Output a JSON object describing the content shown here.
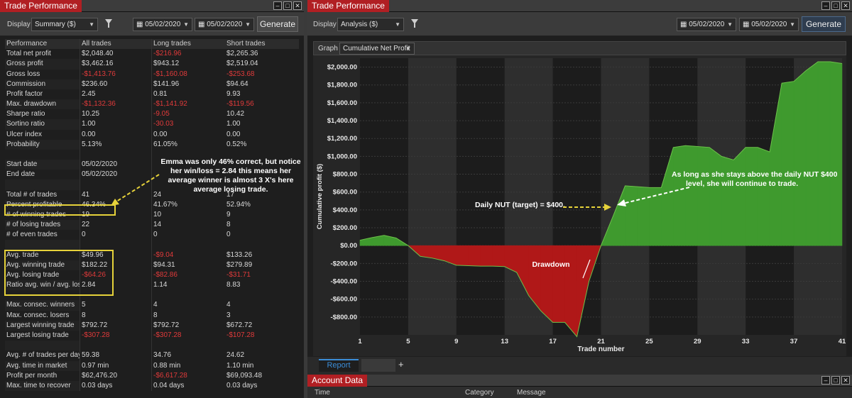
{
  "left_panel": {
    "title": "Trade Performance",
    "display_label": "Display",
    "display_value": "Summary ($)",
    "date_from": "05/02/2020",
    "date_to": "05/02/2020",
    "generate_label": "Generate"
  },
  "table": {
    "headers": [
      "Performance",
      "All trades",
      "Long trades",
      "Short trades"
    ],
    "rows": [
      [
        "Total net profit",
        "$2,048.40",
        "-$216.96",
        "$2,265.36"
      ],
      [
        "Gross profit",
        "$3,462.16",
        "$943.12",
        "$2,519.04"
      ],
      [
        "Gross loss",
        "-$1,413.76",
        "-$1,160.08",
        "-$253.68"
      ],
      [
        "Commission",
        "$236.60",
        "$141.96",
        "$94.64"
      ],
      [
        "Profit factor",
        "2.45",
        "0.81",
        "9.93"
      ],
      [
        "Max. drawdown",
        "-$1,132.36",
        "-$1,141.92",
        "-$119.56"
      ],
      [
        "Sharpe ratio",
        "10.25",
        "-9.05",
        "10.42"
      ],
      [
        "Sortino ratio",
        "1.00",
        "-30.03",
        "1.00"
      ],
      [
        "Ulcer index",
        "0.00",
        "0.00",
        "0.00"
      ],
      [
        "Probability",
        "5.13%",
        "61.05%",
        "0.52%"
      ],
      [
        "",
        "",
        "",
        ""
      ],
      [
        "Start date",
        "05/02/2020",
        "",
        ""
      ],
      [
        "End date",
        "05/02/2020",
        "",
        ""
      ],
      [
        "",
        "",
        "",
        ""
      ],
      [
        "Total # of trades",
        "41",
        "24",
        "17"
      ],
      [
        "Percent profitable",
        "46.34%",
        "41.67%",
        "52.94%"
      ],
      [
        "# of winning trades",
        "19",
        "10",
        "9"
      ],
      [
        "# of losing trades",
        "22",
        "14",
        "8"
      ],
      [
        "# of even trades",
        "0",
        "0",
        "0"
      ],
      [
        "",
        "",
        "",
        ""
      ],
      [
        "Avg. trade",
        "$49.96",
        "-$9.04",
        "$133.26"
      ],
      [
        "Avg. winning trade",
        "$182.22",
        "$94.31",
        "$279.89"
      ],
      [
        "Avg. losing trade",
        "-$64.26",
        "-$82.86",
        "-$31.71"
      ],
      [
        "Ratio avg. win / avg. loss",
        "2.84",
        "1.14",
        "8.83"
      ],
      [
        "",
        "",
        "",
        ""
      ],
      [
        "Max. consec. winners",
        "5",
        "4",
        "4"
      ],
      [
        "Max. consec. losers",
        "8",
        "8",
        "3"
      ],
      [
        "Largest winning trade",
        "$792.72",
        "$792.72",
        "$672.72"
      ],
      [
        "Largest losing trade",
        "-$307.28",
        "-$307.28",
        "-$107.28"
      ],
      [
        "",
        "",
        "",
        ""
      ],
      [
        "Avg. # of trades per day",
        "59.38",
        "34.76",
        "24.62"
      ],
      [
        "Avg. time in market",
        "0.97 min",
        "0.88 min",
        "1.10 min"
      ],
      [
        "Profit per month",
        "$62,476.20",
        "-$6,617.28",
        "$69,093.48"
      ],
      [
        "Max. time to recover",
        "0.03 days",
        "0.04 days",
        "0.03 days"
      ]
    ],
    "annotation": "Emma was only 46% correct, but notice her win/loss = 2.84 this means her average winner is almost 3 X's here average losing trade."
  },
  "right_panel": {
    "title": "Trade Performance",
    "display_label": "Display",
    "display_value": "Analysis ($)",
    "date_from": "05/02/2020",
    "date_to": "05/02/2020",
    "generate_label": "Generate",
    "graph_label": "Graph",
    "graph_value": "Cumulative Net Profit",
    "report_tab": "Report",
    "plus": "+"
  },
  "account_panel": {
    "title": "Account Data",
    "columns": [
      "Time",
      "Category",
      "Message"
    ]
  },
  "chart_data": {
    "type": "area",
    "xlabel": "Trade number",
    "ylabel": "Cumulative profit ($)",
    "ylim": [
      -1000,
      2100
    ],
    "xlim": [
      1,
      41
    ],
    "x_ticks": [
      "1",
      "5",
      "9",
      "13",
      "17",
      "21",
      "25",
      "29",
      "33",
      "37",
      "41"
    ],
    "y_ticks": [
      "$2,000.00",
      "$1,800.00",
      "$1,600.00",
      "$1,400.00",
      "$1,200.00",
      "$1,000.00",
      "$800.00",
      "$600.00",
      "$400.00",
      "$200.00",
      "$0.00",
      "-$200.00",
      "-$400.00",
      "-$600.00",
      "-$800.00"
    ],
    "x": [
      1,
      2,
      3,
      4,
      5,
      6,
      7,
      8,
      9,
      10,
      11,
      12,
      13,
      14,
      15,
      16,
      17,
      18,
      19,
      20,
      21,
      22,
      23,
      24,
      25,
      26,
      27,
      28,
      29,
      30,
      31,
      32,
      33,
      34,
      35,
      36,
      37,
      38,
      39,
      40,
      41
    ],
    "values": [
      60,
      90,
      115,
      85,
      0,
      -120,
      -140,
      -170,
      -220,
      -225,
      -230,
      -230,
      -235,
      -300,
      -560,
      -730,
      -860,
      -860,
      -1020,
      -400,
      0,
      330,
      670,
      660,
      650,
      650,
      1100,
      1120,
      1110,
      1100,
      1000,
      960,
      1100,
      1100,
      1050,
      1820,
      1840,
      1960,
      2060,
      2060,
      2040
    ],
    "positive_color": "#3f9a2e",
    "negative_color": "#b01818",
    "grid": true,
    "annotations": [
      "Daily NUT (target) = $400.",
      "As long as she stays above the daily NUT $400 level, she will continue to trade.",
      "Drawdown"
    ]
  }
}
